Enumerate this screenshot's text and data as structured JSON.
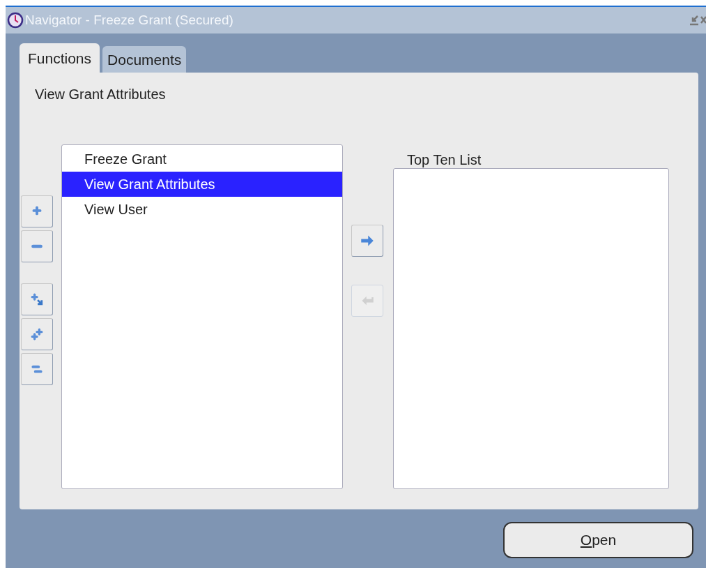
{
  "window": {
    "title": "Navigator - Freeze Grant (Secured)"
  },
  "tabs": [
    {
      "label": "Functions",
      "selected": true
    },
    {
      "label": "Documents",
      "selected": false
    }
  ],
  "heading": "View Grant Attributes",
  "tree_buttons": [
    {
      "kind": "add",
      "disabled": false
    },
    {
      "kind": "remove",
      "disabled": false
    },
    {
      "kind": "expand",
      "disabled": false
    },
    {
      "kind": "expand-all",
      "disabled": false
    },
    {
      "kind": "collapse-all",
      "disabled": false
    }
  ],
  "functions": [
    {
      "label": "Freeze Grant",
      "selected": false
    },
    {
      "label": "View Grant Attributes",
      "selected": true
    },
    {
      "label": "View User",
      "selected": false
    }
  ],
  "move_buttons": [
    {
      "kind": "add-to-list",
      "disabled": false
    },
    {
      "kind": "remove-from-list",
      "disabled": true
    }
  ],
  "top_ten": {
    "label": "Top Ten List"
  },
  "open_button": {
    "label": "Open",
    "underline_first": true
  }
}
